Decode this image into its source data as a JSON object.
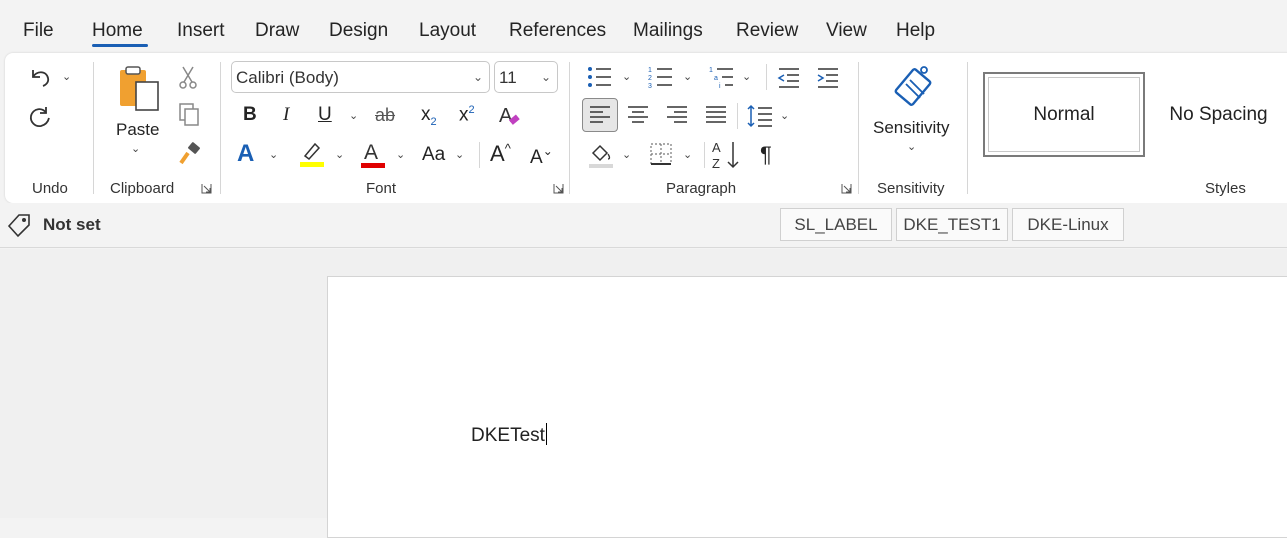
{
  "menu": {
    "tabs": [
      "File",
      "Home",
      "Insert",
      "Draw",
      "Design",
      "Layout",
      "References",
      "Mailings",
      "Review",
      "View",
      "Help"
    ],
    "active": "Home"
  },
  "ribbon": {
    "groups": {
      "undo": "Undo",
      "clipboard": "Clipboard",
      "font": "Font",
      "paragraph": "Paragraph",
      "sensitivity": "Sensitivity",
      "styles": "Styles"
    },
    "paste_label": "Paste",
    "sensitivity_label": "Sensitivity",
    "font_name": "Calibri (Body)",
    "font_size": "11",
    "styles": [
      "Normal",
      "No Spacing"
    ],
    "buttons": {
      "bold": "B",
      "italic": "I",
      "underline": "U",
      "strikethrough": "ab",
      "subscript_base": "x",
      "subscript_mark": "2",
      "superscript_base": "x",
      "superscript_mark": "2",
      "font_color": "A",
      "text_effects": "A",
      "highlight": "A",
      "change_case": "Aa",
      "grow_font": "A",
      "shrink_font": "A",
      "sort_a": "A",
      "sort_z": "Z",
      "pilcrow": "¶"
    },
    "colors": {
      "accent": "#1a5fb4",
      "highlight": "#ffff00",
      "font_color": "#e00000"
    }
  },
  "sensitivity_bar": {
    "status": "Not set",
    "labels": [
      "SL_LABEL",
      "DKE_TEST1",
      "DKE-Linux"
    ]
  },
  "document": {
    "text": "DKETest"
  }
}
